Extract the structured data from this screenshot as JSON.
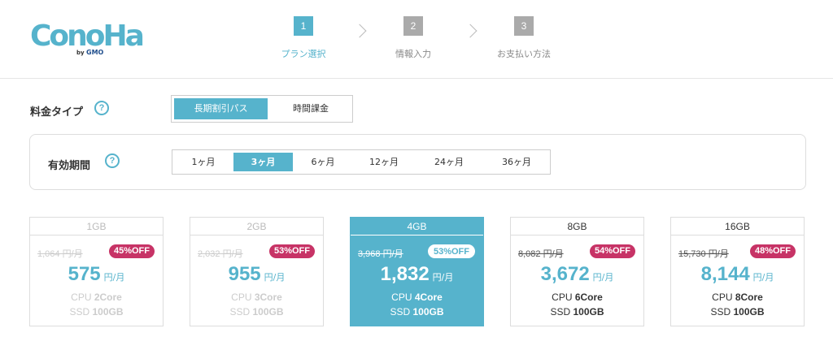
{
  "brand": {
    "logo_text": "ConoHa",
    "logo_by": "by",
    "logo_gmo": "GMO"
  },
  "steps": [
    {
      "num": "1",
      "label": "プラン選択"
    },
    {
      "num": "2",
      "label": "情報入力"
    },
    {
      "num": "3",
      "label": "お支払い方法"
    }
  ],
  "plan_type": {
    "label": "料金タイプ",
    "help": "?",
    "options": [
      "長期割引パス",
      "時間課金"
    ],
    "selected": "長期割引パス"
  },
  "period": {
    "label": "有効期間",
    "help": "?",
    "options": [
      "1ヶ月",
      "3ヶ月",
      "6ヶ月",
      "12ヶ月",
      "24ヶ月",
      "36ヶ月"
    ],
    "selected": "3ヶ月"
  },
  "plans": [
    {
      "name": "1GB",
      "old_price": "1,064 円/月",
      "off": "45%OFF",
      "price": "575",
      "unit": "円/月",
      "cpu_prefix": "CPU ",
      "cpu": "2Core",
      "ssd_prefix": "SSD ",
      "ssd": "100GB"
    },
    {
      "name": "2GB",
      "old_price": "2,032 円/月",
      "off": "53%OFF",
      "price": "955",
      "unit": "円/月",
      "cpu_prefix": "CPU ",
      "cpu": "3Core",
      "ssd_prefix": "SSD ",
      "ssd": "100GB"
    },
    {
      "name": "4GB",
      "old_price": "3,968 円/月",
      "off": "53%OFF",
      "price": "1,832",
      "unit": "円/月",
      "cpu_prefix": "CPU ",
      "cpu": "4Core",
      "ssd_prefix": "SSD ",
      "ssd": "100GB"
    },
    {
      "name": "8GB",
      "old_price": "8,082 円/月",
      "off": "54%OFF",
      "price": "3,672",
      "unit": "円/月",
      "cpu_prefix": "CPU ",
      "cpu": "6Core",
      "ssd_prefix": "SSD ",
      "ssd": "100GB"
    },
    {
      "name": "16GB",
      "old_price": "15,730 円/月",
      "off": "48%OFF",
      "price": "8,144",
      "unit": "円/月",
      "cpu_prefix": "CPU ",
      "cpu": "8Core",
      "ssd_prefix": "SSD ",
      "ssd": "100GB"
    }
  ],
  "colors": {
    "accent": "#56b3cc",
    "discount": "#c73366",
    "border": "#dddddd"
  }
}
